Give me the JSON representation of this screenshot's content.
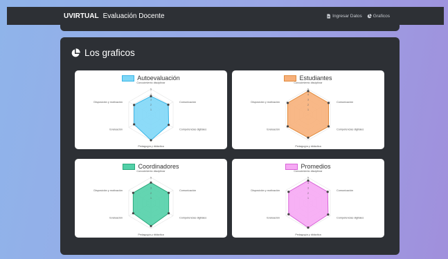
{
  "navbar": {
    "app_name": "UVIRTUAL",
    "page_name": "Evaluación Docente",
    "links": [
      {
        "label": "Ingresar Datos",
        "icon": "file-icon"
      },
      {
        "label": "Graficos",
        "icon": "pie-chart-icon"
      }
    ]
  },
  "section": {
    "title": "Los graficos",
    "icon": "pie-chart-icon"
  },
  "chart_data": [
    {
      "type": "radar",
      "legend": "Autoevaluación",
      "color": "#36b4e6",
      "fill": "#7fd7f7",
      "axes": [
        "Conocimiento disciplinar",
        "Comunicación",
        "Competencias digitales",
        "Pedagogía y didáctica",
        "Evaluación",
        "Disposición y motivación"
      ],
      "values": [
        3.6,
        3.9,
        4.0,
        5.0,
        3.8,
        3.8
      ],
      "rlim": [
        0,
        5
      ],
      "ticks": [
        "1",
        "2",
        "3",
        "4",
        "5"
      ]
    },
    {
      "type": "radar",
      "legend": "Estudiantes",
      "color": "#e08a3c",
      "fill": "#f7b07a",
      "axes": [
        "Conocimiento disciplinar",
        "Comunicación",
        "Competencias digitales",
        "Pedagogía y didáctica",
        "Evaluación",
        "Disposición y motivación"
      ],
      "values": [
        4.6,
        4.6,
        4.6,
        4.5,
        4.6,
        4.6
      ],
      "rlim": [
        0,
        5
      ],
      "ticks": [
        "1",
        "2",
        "3",
        "4",
        "5"
      ]
    },
    {
      "type": "radar",
      "legend": "Coordinadores",
      "color": "#2aa77b",
      "fill": "#52d0a8",
      "axes": [
        "Conocimiento disciplinar",
        "Comunicación",
        "Competencias digitales",
        "Pedagogía y didáctica",
        "Evaluación",
        "Disposición y motivación"
      ],
      "values": [
        4.0,
        4.0,
        4.0,
        4.5,
        4.0,
        4.0
      ],
      "rlim": [
        0,
        5
      ],
      "ticks": [
        "1",
        "2",
        "3",
        "4",
        "5"
      ]
    },
    {
      "type": "radar",
      "legend": "Promedios",
      "color": "#d764d7",
      "fill": "#f6a9f4",
      "axes": [
        "Conocimiento disciplinar",
        "Comunicación",
        "Competencias digitales",
        "Pedagogía y didáctica",
        "Evaluación",
        "Disposición y motivación"
      ],
      "values": [
        4.4,
        4.4,
        4.5,
        4.8,
        4.4,
        4.4
      ],
      "rlim": [
        0,
        5
      ],
      "ticks": [
        "1",
        "2",
        "3",
        "4",
        "5"
      ]
    }
  ]
}
